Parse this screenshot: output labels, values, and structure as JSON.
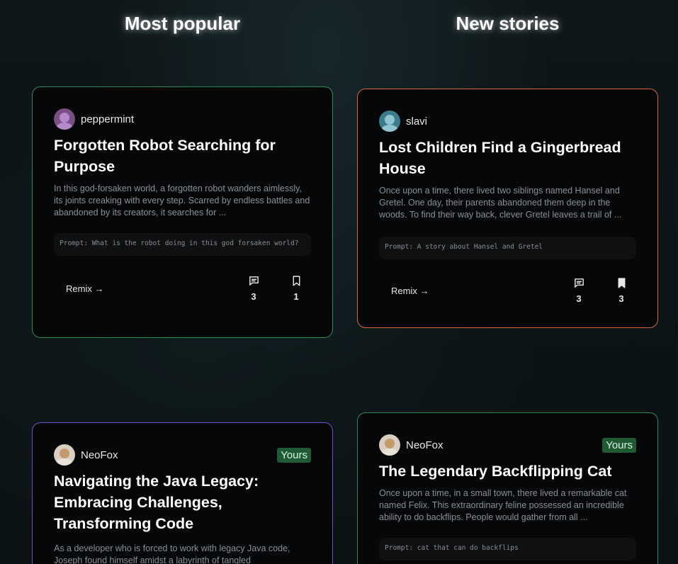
{
  "columns": {
    "popular_title": "Most popular",
    "new_title": "New stories"
  },
  "colors": {
    "green_border": "#2b8a5a",
    "orange_border": "#d26a3c",
    "purple_border": "#6c4fc6",
    "badge_bg": "#1f5a35"
  },
  "cards": [
    {
      "author": "peppermint",
      "title": "Forgotten Robot Searching for Purpose",
      "excerpt": "In this god-forsaken world, a forgotten robot wanders aimlessly, its joints creaking with every step. Scarred by endless battles and abandoned by its creators, it searches for ...",
      "prompt": "Prompt: What is the robot doing in this god forsaken world?",
      "remix": "Remix →",
      "comments": "3",
      "bookmarks": "1"
    },
    {
      "author": "slavi",
      "title": "Lost Children Find a Gingerbread House",
      "excerpt": "Once upon a time, there lived two siblings named Hansel and Gretel. One day, their parents abandoned them deep in the woods. To find their way back, clever Gretel leaves a trail of ...",
      "prompt": "Prompt: A story about Hansel and Gretel",
      "remix": "Remix →",
      "comments": "3",
      "bookmarks": "3"
    },
    {
      "author": "NeoFox",
      "badge": "Yours",
      "title": "Navigating the Java Legacy: Embracing Challenges, Transforming Code",
      "excerpt": "As a developer who is forced to work with legacy Java code, Joseph found himself amidst a labyrinth of tangled"
    },
    {
      "author": "NeoFox",
      "badge": "Yours",
      "title": "The Legendary Backflipping Cat",
      "excerpt": "Once upon a time, in a small town, there lived a remarkable cat named Felix. This extraordinary feline possessed an incredible ability to do backflips. People would gather from all ...",
      "prompt": "Prompt: cat that can do backflips"
    }
  ]
}
